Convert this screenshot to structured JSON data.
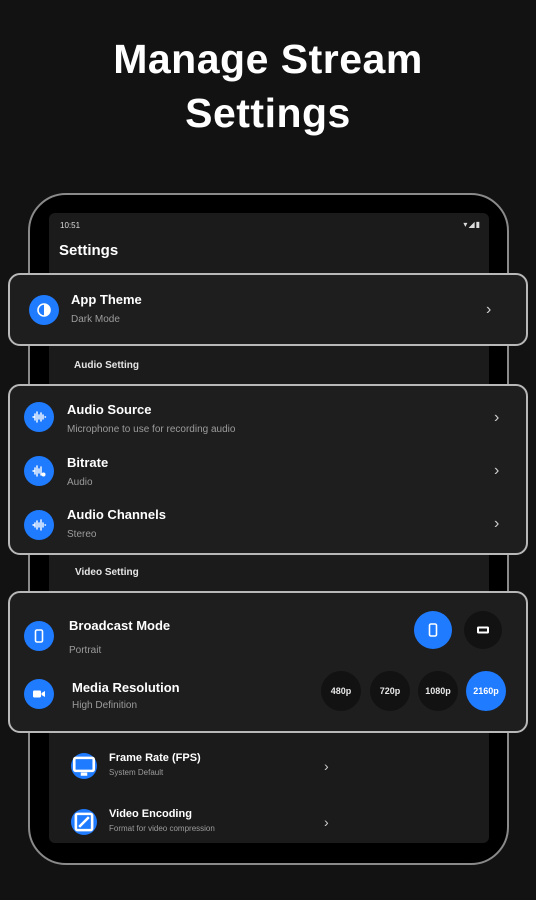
{
  "headline": {
    "line1": "Manage Stream",
    "line2": "Settings"
  },
  "status_bar": {
    "time": "10:51",
    "icons": "▾◢▮"
  },
  "screen_title": "Settings",
  "app_theme": {
    "title": "App Theme",
    "subtitle": "Dark Mode",
    "icon": "theme-icon"
  },
  "audio_section_label": "Audio Setting",
  "audio_items": [
    {
      "title": "Audio Source",
      "subtitle": "Microphone to use for recording audio",
      "icon": "audio-wave-icon"
    },
    {
      "title": "Bitrate",
      "subtitle": "Audio",
      "icon": "bitrate-icon"
    },
    {
      "title": "Audio Channels",
      "subtitle": "Stereo",
      "icon": "audio-channels-icon"
    }
  ],
  "video_section_label": "Video Setting",
  "broadcast_mode": {
    "title": "Broadcast Mode",
    "subtitle": "Portrait",
    "selected": "portrait"
  },
  "media_resolution": {
    "title": "Media Resolution",
    "subtitle": "High Definition",
    "options": [
      "480p",
      "720p",
      "1080p",
      "2160p"
    ],
    "selected": "2160p"
  },
  "frame_rate": {
    "title": "Frame Rate (FPS)",
    "subtitle": "System Default"
  },
  "video_encoding": {
    "title": "Video Encoding",
    "subtitle": "Format for video compression"
  },
  "colors": {
    "accent": "#1f7bff",
    "background": "#121212",
    "card": "#1e1e1e",
    "card_border": "#b8b8b8"
  }
}
